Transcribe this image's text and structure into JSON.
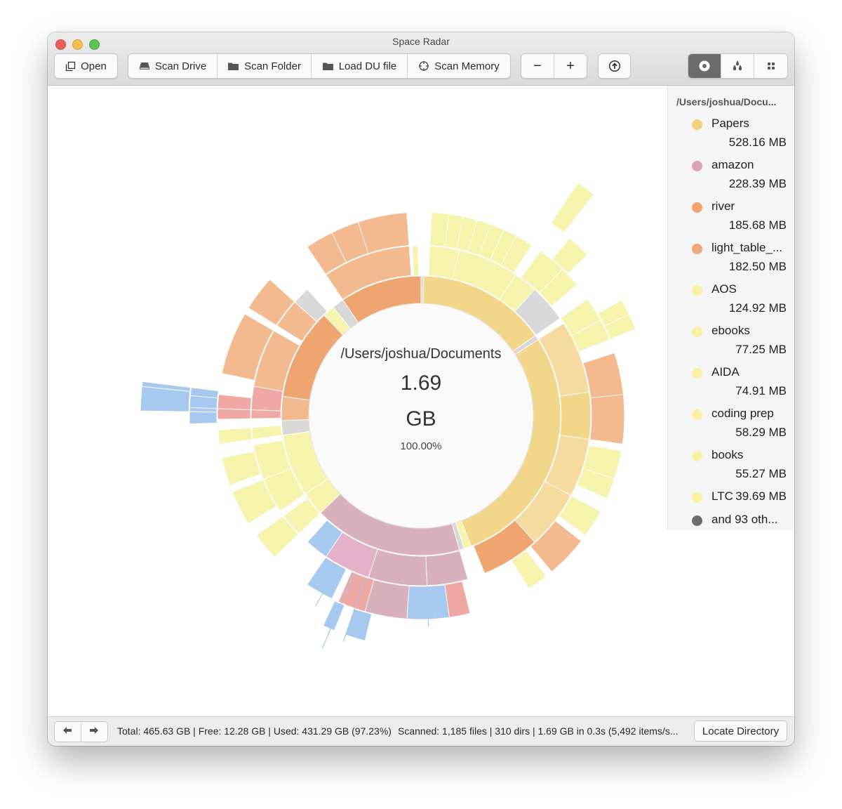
{
  "window": {
    "title": "Space Radar"
  },
  "toolbar": {
    "open": "Open",
    "scan_drive": "Scan Drive",
    "scan_folder": "Scan Folder",
    "load_du": "Load DU file",
    "scan_memory": "Scan Memory",
    "zoom_out": "−",
    "zoom_in": "+",
    "icons": {
      "open": "open-window-icon",
      "scan_drive": "drive-icon",
      "scan_folder": "folder-icon",
      "load_du": "folder-icon",
      "scan_memory": "crosshair-icon",
      "upload": "upload-circle-icon",
      "view_sunburst": "sunburst-view-icon",
      "view_flame": "drops-view-icon",
      "view_treemap": "grid-view-icon"
    },
    "active_view": "sunburst"
  },
  "center": {
    "path": "/Users/joshua/Documents",
    "size_value": "1.69",
    "size_unit": "GB",
    "percent": "100.00%"
  },
  "legend": {
    "title": "/Users/joshua/Docu...",
    "items": [
      {
        "name": "Papers",
        "size": "528.16 MB",
        "color": "#f2d07d"
      },
      {
        "name": "amazon",
        "size": "228.39 MB",
        "color": "#d9a4b4"
      },
      {
        "name": "river",
        "size": "185.68 MB",
        "color": "#efa46f"
      },
      {
        "name": "light_table_...",
        "size": "182.50 MB",
        "color": "#f0a87f"
      },
      {
        "name": "AOS",
        "size": "124.92 MB",
        "color": "#f6f1a3"
      },
      {
        "name": "ebooks",
        "size": "77.25 MB",
        "color": "#f6f1a3"
      },
      {
        "name": "AIDA",
        "size": "74.91 MB",
        "color": "#f6f1a3"
      },
      {
        "name": "coding prep",
        "size": "58.29 MB",
        "color": "#f6f1a3"
      },
      {
        "name": "books",
        "size": "55.27 MB",
        "color": "#f6f1a3"
      },
      {
        "name": "LTC",
        "size": "39.69 MB",
        "color": "#f6f1a3"
      },
      {
        "name": "and 93 oth...",
        "size": "",
        "color": "#6e6e6e"
      }
    ]
  },
  "statusbar": {
    "disk": "Total: 465.63 GB | Free: 12.28 GB | Used: 431.29 GB (97.23%)",
    "scan": "Scanned: 1,185 files | 310 dirs | 1.69 GB in 0.3s (5,492 items/s...",
    "locate": "Locate Directory"
  }
}
